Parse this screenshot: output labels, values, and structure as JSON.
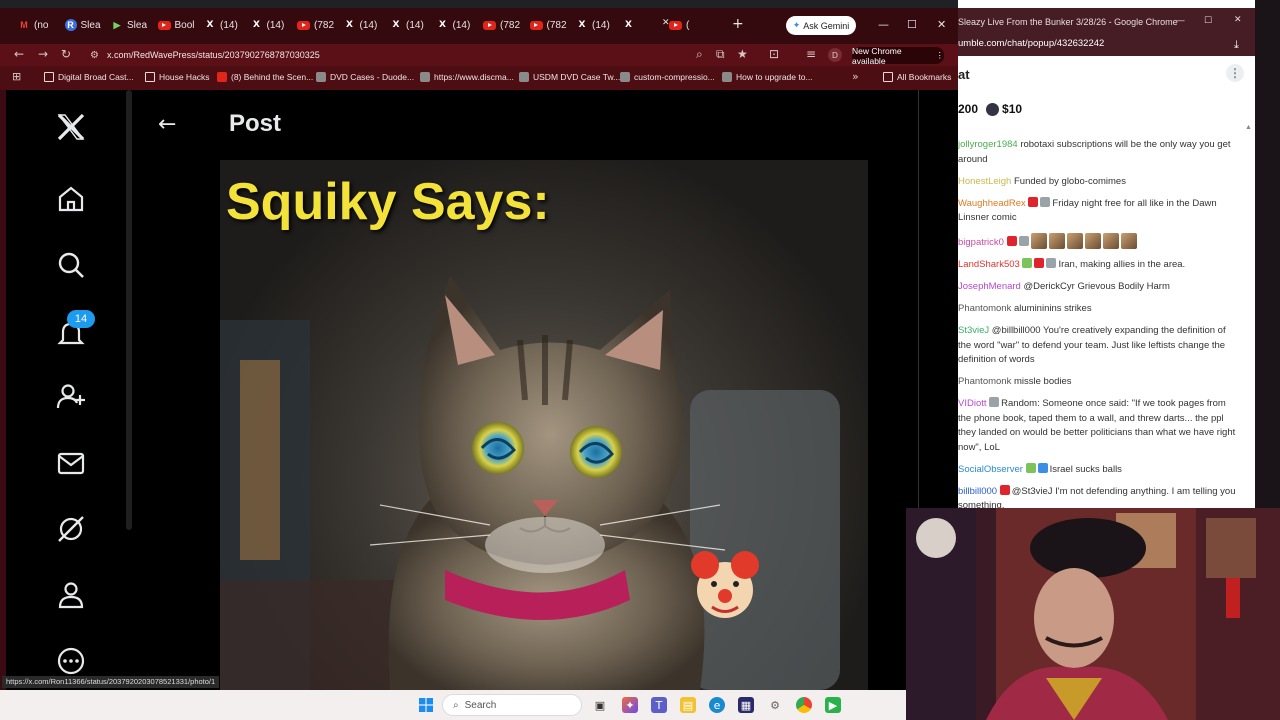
{
  "tabs": [
    {
      "label": "(no",
      "icon": "gmail-icon"
    },
    {
      "label": "Slea",
      "icon": "r-icon"
    },
    {
      "label": "Slea",
      "icon": "rumble-play-icon"
    },
    {
      "label": "Bool",
      "icon": "youtube-icon"
    },
    {
      "label": "(14)",
      "icon": "x-icon"
    },
    {
      "label": "(14)",
      "icon": "x-icon"
    },
    {
      "label": "(782",
      "icon": "youtube-icon"
    },
    {
      "label": "(14)",
      "icon": "x-icon"
    },
    {
      "label": "(14)",
      "icon": "x-icon"
    },
    {
      "label": "(14)",
      "icon": "x-icon"
    },
    {
      "label": "(782",
      "icon": "youtube-icon"
    },
    {
      "label": "(782",
      "icon": "youtube-icon"
    },
    {
      "label": "(14)",
      "icon": "x-icon"
    },
    {
      "label": "",
      "icon": "x-icon"
    },
    {
      "label": "(",
      "icon": "youtube-icon"
    }
  ],
  "toolbar": {
    "ask_gemini": "Ask Gemini",
    "url": "x.com/RedWavePress/status/2037902768787030325",
    "new_chrome": "New Chrome available",
    "profile_letter": "D"
  },
  "bookmarks": [
    {
      "label": "Digital Broad Cast...",
      "icon": "folder-icon"
    },
    {
      "label": "House Hacks",
      "icon": "folder-icon"
    },
    {
      "label": "(8) Behind the Scen...",
      "icon": "youtube-icon"
    },
    {
      "label": "DVD Cases - Duode...",
      "icon": "site-icon"
    },
    {
      "label": "https://www.discma...",
      "icon": "site-icon"
    },
    {
      "label": "USDM DVD Case Tw...",
      "icon": "site-icon"
    },
    {
      "label": "custom-compressio...",
      "icon": "site-icon"
    },
    {
      "label": "How to upgrade to...",
      "icon": "site-icon"
    },
    {
      "label": "All Bookmarks",
      "icon": "folder-icon"
    }
  ],
  "x": {
    "post_title": "Post",
    "notification_count": "14",
    "image_text": "Squiky Says:",
    "status_url": "https://x.com/Ron11366/status/2037920203078521331/photo/1"
  },
  "chat": {
    "title": "Sleazy Live From the Bunker 3/28/26 - Google Chrome",
    "url": "umble.com/chat/popup/432632242",
    "header": "at",
    "count": "200",
    "amount": "$10",
    "messages": [
      {
        "user": "",
        "text": "",
        "color": "#999999",
        "badges": []
      },
      {
        "user": "jollyroger1984",
        "text": "robotaxi subscriptions will be the only way you get around",
        "color": "#4bae4f",
        "badges": []
      },
      {
        "user": "HonestLeigh",
        "text": "Funded by globo-comimes",
        "color": "#c9b94a",
        "badges": []
      },
      {
        "user": "WaughheadRex",
        "text": "Friday night free for all like in the Dawn Linsner comic",
        "color": "#e07a22",
        "badges": [
          "red",
          "gray"
        ]
      },
      {
        "user": "bigpatrick0",
        "text": "",
        "color": "#c94aa4",
        "badges": [
          "red",
          "gray"
        ],
        "emotes": 6
      },
      {
        "user": "LandShark503",
        "text": "Iran, making allies in the area.",
        "color": "#e2332f",
        "badges": [
          "green",
          "red",
          "gray"
        ]
      },
      {
        "user": "JosephMenard",
        "text": "@DerickCyr Grievous Bodily Harm",
        "color": "#b54ad0",
        "badges": []
      },
      {
        "user": "Phantomonk",
        "text": "alumininins strikes",
        "color": "#555555",
        "badges": []
      },
      {
        "user": "St3vieJ",
        "text": "@billbill000 You're creatively expanding the definition of the word \"war\" to defend your team. Just like leftists change the definition of words",
        "color": "#3aaf6a",
        "badges": []
      },
      {
        "user": "Phantomonk",
        "text": "missle bodies",
        "color": "#555555",
        "badges": []
      },
      {
        "user": "VIDiott",
        "text": "Random: Someone once said: \"If we took pages from the phone book, taped them to a wall, and threw darts... the ppl they landed on would be better politicians than what we have right now\", LoL",
        "color": "#b54ad0",
        "badges": [
          "gray"
        ]
      },
      {
        "user": "SocialObserver",
        "text": "Israel sucks balls",
        "color": "#2a8ad6",
        "badges": [
          "green",
          "blue"
        ]
      },
      {
        "user": "billbill000",
        "text": "@St3vieJ I'm not defending anything. I am telling you something.",
        "color": "#2a5cd6",
        "badges": [
          "red"
        ]
      }
    ]
  },
  "taskbar": {
    "search_placeholder": "Search"
  }
}
